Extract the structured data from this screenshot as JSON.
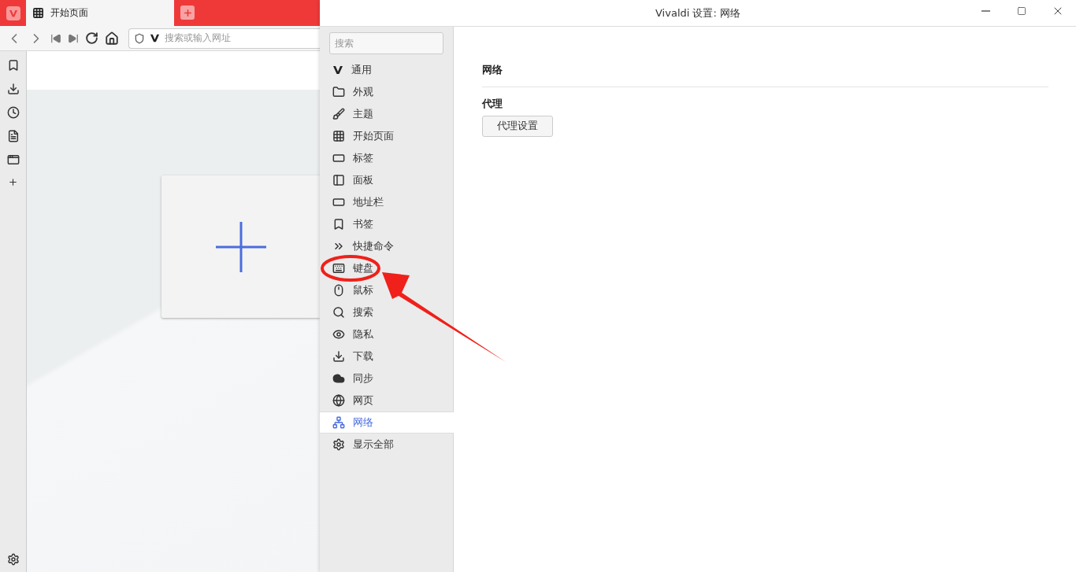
{
  "browser": {
    "tab": {
      "title": "开始页面",
      "selected": true
    },
    "address_bar": {
      "placeholder": "搜索或输入网址"
    }
  },
  "settings": {
    "title": "Vivaldi 设置: 网络",
    "search": {
      "placeholder": "搜索"
    },
    "nav": [
      {
        "label": "通用",
        "selected": false
      },
      {
        "label": "外观",
        "selected": false
      },
      {
        "label": "主题",
        "selected": false
      },
      {
        "label": "开始页面",
        "selected": false
      },
      {
        "label": "标签",
        "selected": false
      },
      {
        "label": "面板",
        "selected": false
      },
      {
        "label": "地址栏",
        "selected": false
      },
      {
        "label": "书签",
        "selected": false
      },
      {
        "label": "快捷命令",
        "selected": false
      },
      {
        "label": "键盘",
        "selected": false
      },
      {
        "label": "鼠标",
        "selected": false
      },
      {
        "label": "搜索",
        "selected": false
      },
      {
        "label": "隐私",
        "selected": false
      },
      {
        "label": "下载",
        "selected": false
      },
      {
        "label": "同步",
        "selected": false
      },
      {
        "label": "网页",
        "selected": false
      },
      {
        "label": "网络",
        "selected": true
      },
      {
        "label": "显示全部",
        "selected": false
      }
    ],
    "section_title": "网络",
    "group_title": "代理",
    "button": "代理设置"
  }
}
